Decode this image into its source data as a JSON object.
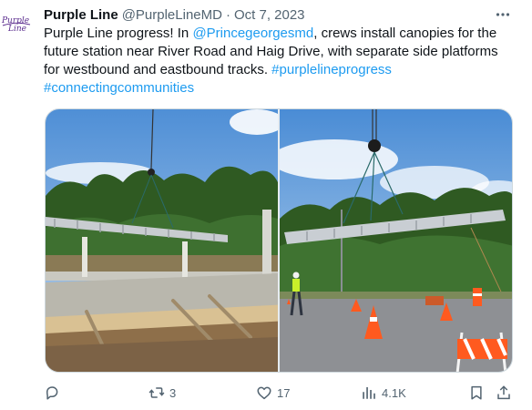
{
  "tweet": {
    "author_name": "Purple Line",
    "handle": "@PurpleLineMD",
    "separator": "·",
    "date": "Oct 7, 2023",
    "avatar_text": "Purple Line",
    "text_1": "Purple Line progress! In ",
    "mention": "@Princegeorgesmd",
    "text_2": ", crews install canopies for the future station near River Road and Haig Drive, with separate side platforms for westbound and eastbound tracks. ",
    "hashtag_1": "#purplelineprogress",
    "hashtag_2": "#connectingcommunities",
    "brand_color": "#5b2d8e",
    "link_color": "#1d9bf0"
  },
  "media": {
    "photo_left": "canopy-frame-on-platform-photo",
    "photo_right": "crane-lifting-canopy-photo"
  },
  "actions": {
    "reply_count": "",
    "repost_count": "3",
    "like_count": "17",
    "views_count": "4.1K"
  },
  "icons": [
    "more-icon",
    "reply-icon",
    "repost-icon",
    "like-icon",
    "views-icon",
    "bookmark-icon",
    "share-icon"
  ]
}
